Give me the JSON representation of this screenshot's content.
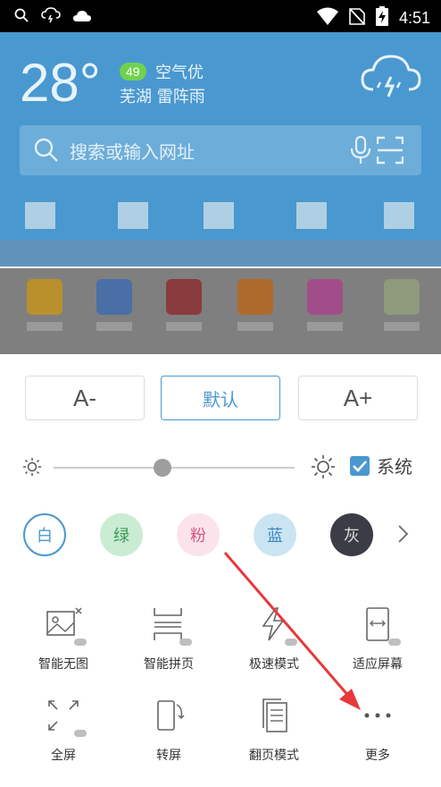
{
  "status_bar": {
    "time": "4:51",
    "icons": [
      "search-icon",
      "weather-thunder-icon",
      "cloud-icon",
      "wifi-icon",
      "no-sim-icon",
      "battery-charging-icon"
    ]
  },
  "weather": {
    "temperature": "28°",
    "aqi_value": "49",
    "aqi_text": "空气优",
    "location_and_condition": "芜湖 雷阵雨",
    "icon": "thunderstorm-cloud-icon"
  },
  "search": {
    "placeholder": "搜索或输入网址",
    "icons": [
      "search-icon",
      "microphone-icon",
      "scan-icon"
    ]
  },
  "font_size": {
    "decrease_label": "A-",
    "default_label": "默认",
    "increase_label": "A+"
  },
  "brightness": {
    "level": 0.45,
    "system_label": "系统",
    "system_checked": true
  },
  "themes": [
    {
      "label": "白",
      "bg": "#ffffff",
      "fg": "#4a98d0",
      "selected": true
    },
    {
      "label": "绿",
      "bg": "#c9ecd2",
      "fg": "#3a9b5a"
    },
    {
      "label": "粉",
      "bg": "#fbe3ec",
      "fg": "#d2557f"
    },
    {
      "label": "蓝",
      "bg": "#cbe4f2",
      "fg": "#3b86bf"
    },
    {
      "label": "灰",
      "bg": "#3a3d45",
      "fg": "#dddddd"
    }
  ],
  "features": [
    {
      "label": "智能无图",
      "icon": "image-off-icon"
    },
    {
      "label": "智能拼页",
      "icon": "page-merge-icon"
    },
    {
      "label": "极速模式",
      "icon": "lightning-icon"
    },
    {
      "label": "适应屏幕",
      "icon": "fit-screen-icon"
    },
    {
      "label": "全屏",
      "icon": "fullscreen-icon"
    },
    {
      "label": "转屏",
      "icon": "rotate-screen-icon"
    },
    {
      "label": "翻页模式",
      "icon": "page-flip-icon"
    },
    {
      "label": "更多",
      "icon": "more-icon"
    }
  ],
  "colors": {
    "accent": "#4a98d0",
    "header": "#4a98d0",
    "annotation_arrow": "#e8383b"
  }
}
